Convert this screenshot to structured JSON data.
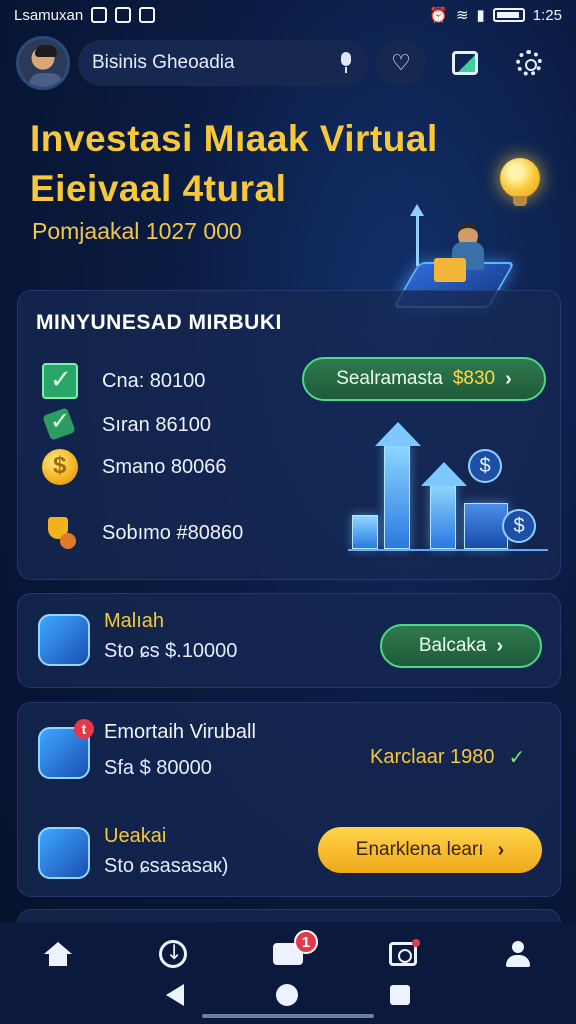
{
  "status_bar": {
    "carrier": "Lsamuxan",
    "time": "1:25"
  },
  "top_bar": {
    "search_text": "Bisinis Gheoadia"
  },
  "hero": {
    "title_line1": "Investasi Mıaak Virtual",
    "title_line2": "Eieivaal 4tural",
    "subtitle": "Pomjaakal 1027 000"
  },
  "summary_card": {
    "title": "MINYUNESAD MIRBUKI",
    "stats": [
      {
        "icon": "check-icon",
        "label": "Cna: 80100"
      },
      {
        "icon": "pen-check-icon",
        "label": "Sıran 86100"
      },
      {
        "icon": "coin-icon",
        "label": "Smano 80066"
      },
      {
        "icon": "trophy-icon",
        "label": "Sobımo #80860"
      }
    ],
    "action": {
      "label": "Sealramasta",
      "amount": "$830",
      "chevron": "›"
    }
  },
  "item_1": {
    "title": "Malıah",
    "subtitle": "Sto ɕs $.10000",
    "action_label": "Balcaka",
    "chevron": "›"
  },
  "item_2": {
    "title": "Emortaih Viruball",
    "subtitle": "Sfa $ 80000",
    "badge": "t",
    "status": "Karclaar 1980",
    "status_mark": "✓"
  },
  "item_3": {
    "title": "Ueakai",
    "subtitle": "Sto ɕsasasaк)",
    "action_label": "Enarklena learı",
    "chevron": "›"
  },
  "bottom_nav": {
    "badge_count": "1"
  },
  "colors": {
    "accent_gold": "#f6c83a",
    "action_green": "#2f7a4f",
    "action_yellow": "#ffd44a",
    "badge_red": "#e23a4a",
    "background": "#0a1a3f"
  }
}
